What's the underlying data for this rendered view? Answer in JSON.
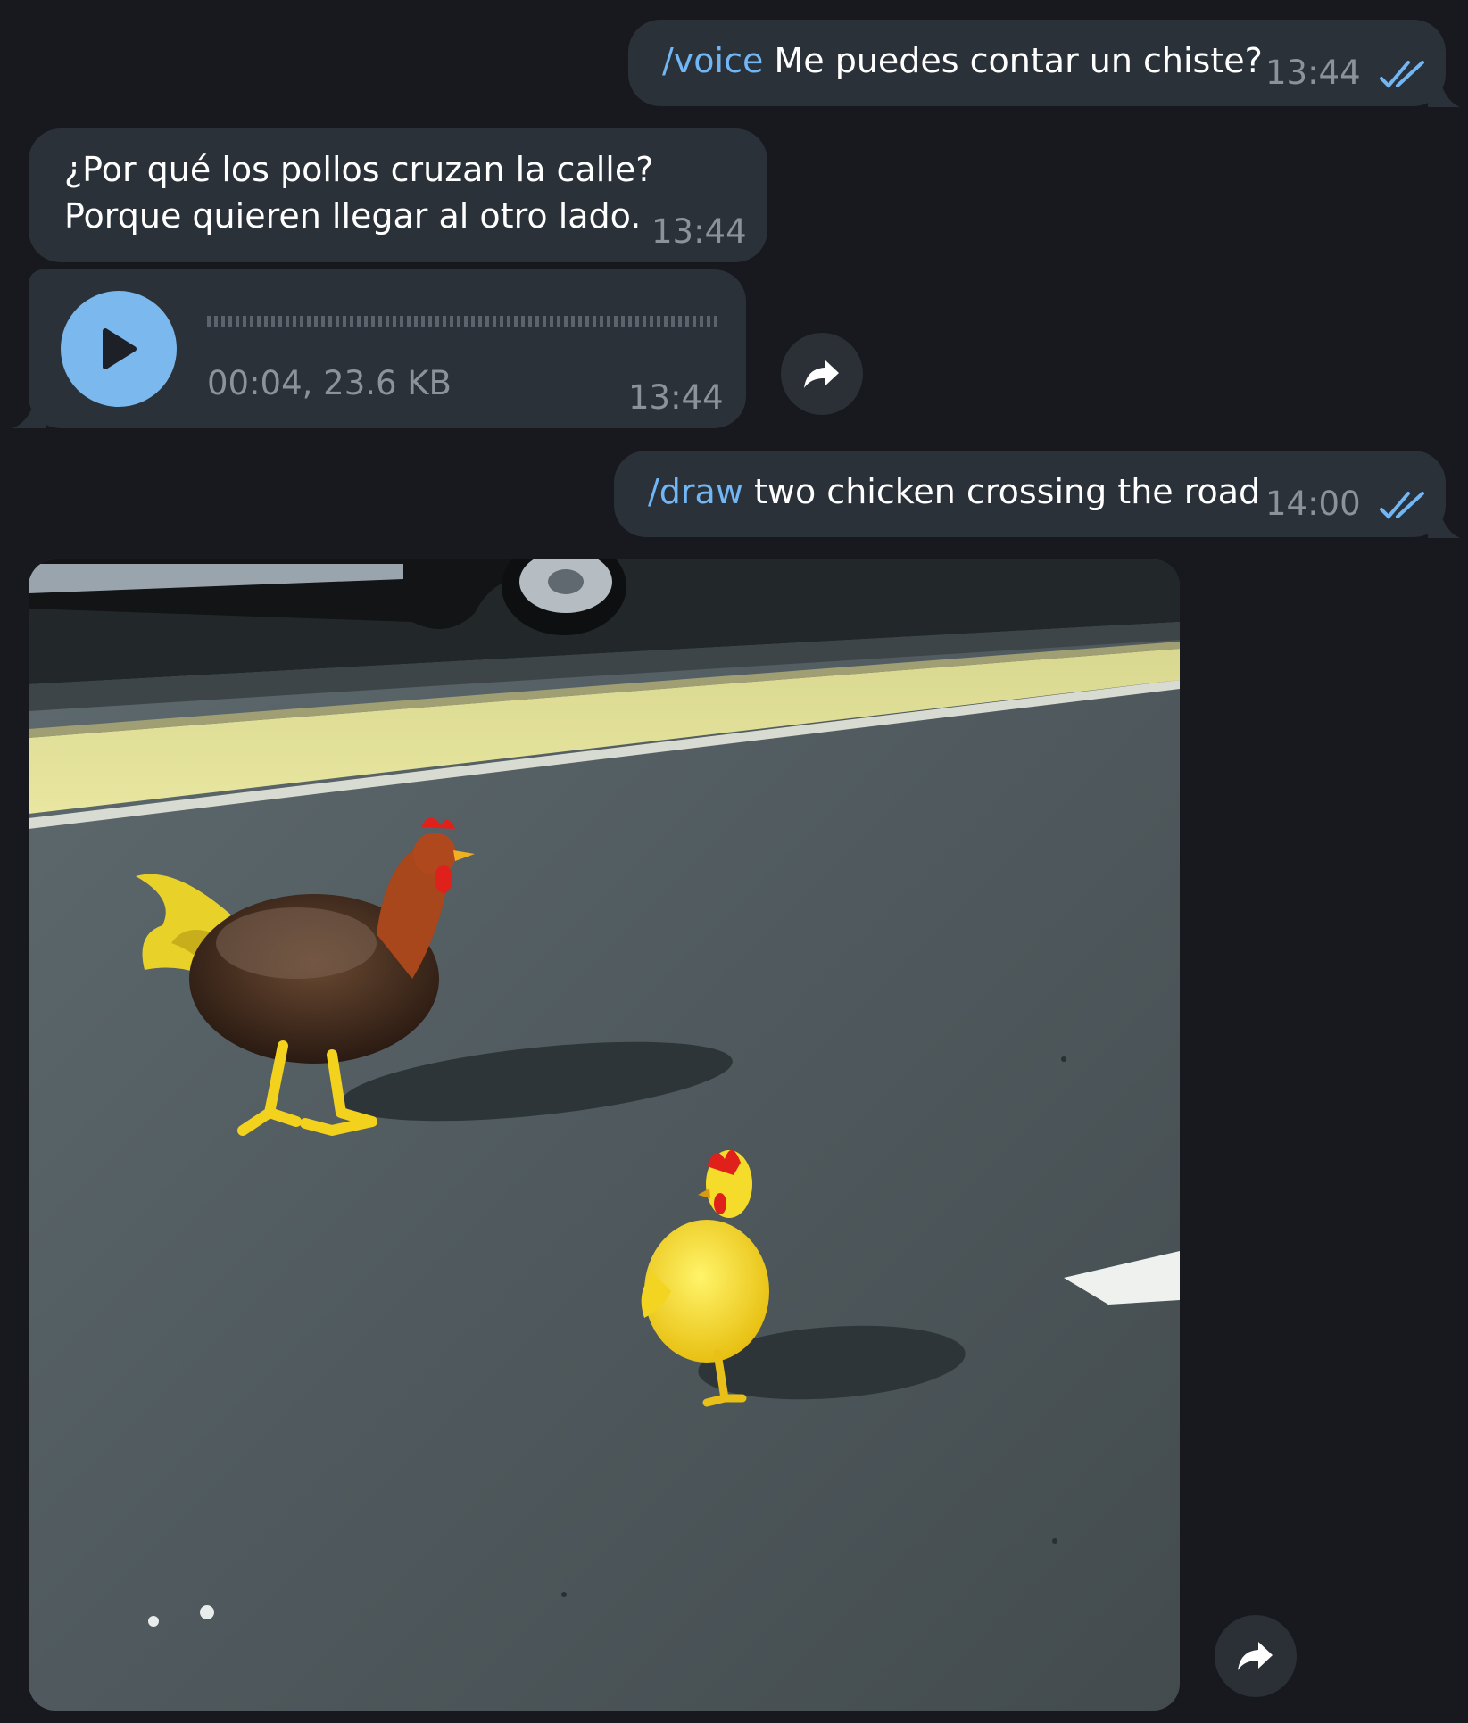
{
  "messages": {
    "voice_cmd": {
      "command": "/voice",
      "text": " Me puedes contar un chiste?",
      "time": "13:44"
    },
    "joke": {
      "line1": "¿Por qué los pollos cruzan la calle?",
      "line2": "Porque quieren llegar al otro lado.",
      "time": "13:44"
    },
    "audio": {
      "meta": "00:04, 23.6 KB",
      "time": "13:44"
    },
    "draw_cmd": {
      "command": "/draw",
      "text": " two chicken crossing the road",
      "time": "14:00"
    }
  },
  "icons": {
    "read_receipt": "double-check-icon",
    "forward": "forward-arrow-icon",
    "play": "play-icon"
  },
  "colors": {
    "background": "#17191e",
    "bubble": "#2b3138",
    "command": "#71b6f5",
    "play_button": "#7ab8ee",
    "timestamp": "#8b929a"
  }
}
